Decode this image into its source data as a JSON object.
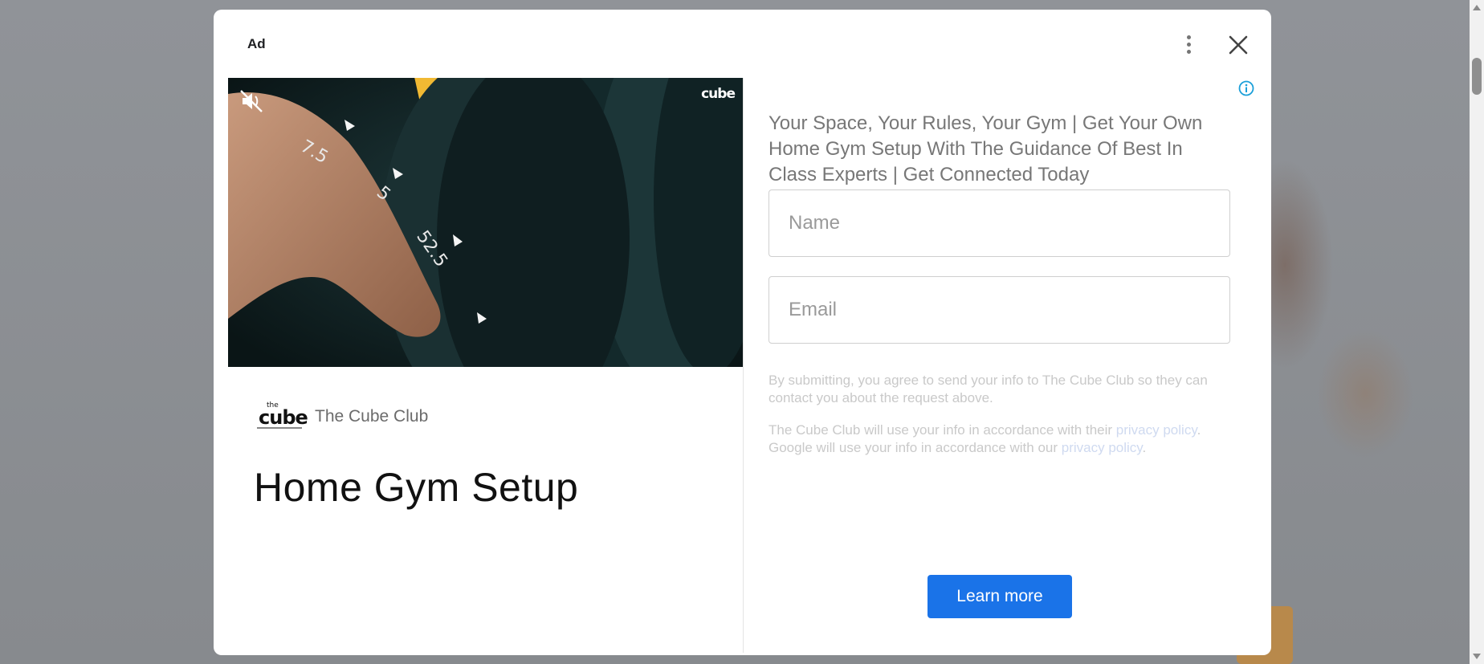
{
  "modal": {
    "ad_label": "Ad",
    "video": {
      "logo_text": "cube"
    },
    "advertiser": {
      "logo_text_small": "the",
      "logo_text_main": "cube",
      "name": "The Cube Club"
    },
    "headline": "Home Gym Setup",
    "description": "Your Space, Your Rules, Your Gym | Get Your Own Home Gym Setup With The Guidance Of Best In Class Experts | Get Connected Today",
    "form": {
      "name_placeholder": "Name",
      "email_placeholder": "Email"
    },
    "consent_text": "By submitting, you agree to send your info to The Cube Club so they can contact you about the request above.",
    "policy": {
      "part1": "The Cube Club will use your info in accordance with their ",
      "link1": "privacy policy",
      "part2": ". Google will use your info in accordance with our ",
      "link2": "privacy policy",
      "part3": "."
    },
    "cta_label": "Learn more"
  },
  "icons": {
    "more": "more-vertical-icon",
    "close": "close-icon",
    "mute": "volume-muted-icon",
    "info": "info-icon"
  },
  "colors": {
    "accent": "#1a73e8",
    "info": "#1a9fd9"
  }
}
